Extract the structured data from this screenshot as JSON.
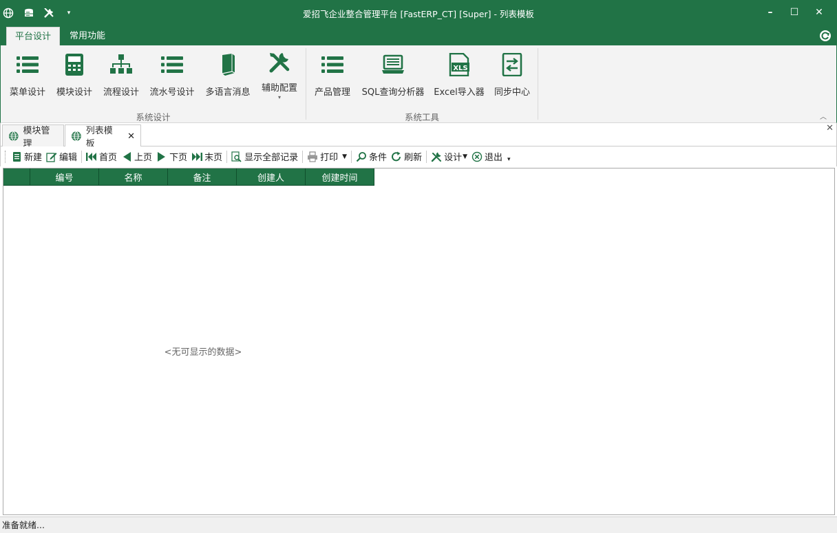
{
  "window": {
    "title": "爱招飞企业整合管理平台 [FastERP_CT] [Super] - 列表模板",
    "minimize_glyph": "–",
    "maximize_glyph": "☐",
    "close_glyph": "✕"
  },
  "quick_access": [
    "globe-icon",
    "database-icon",
    "tools-icon",
    "dropdown-arrow-icon"
  ],
  "ribbon_tabs": [
    {
      "label": "平台设计",
      "active": true
    },
    {
      "label": "常用功能",
      "active": false
    }
  ],
  "ribbon": {
    "groups": [
      {
        "label": "系统设计",
        "buttons": [
          {
            "label": "菜单设计",
            "icon": "list-icon"
          },
          {
            "label": "模块设计",
            "icon": "calculator-icon"
          },
          {
            "label": "流程设计",
            "icon": "org-chart-icon"
          },
          {
            "label": "流水号设计",
            "icon": "list-icon"
          },
          {
            "label": "多语言消息",
            "icon": "book-icon"
          },
          {
            "label": "辅助配置",
            "icon": "tools-icon",
            "dropdown": true
          }
        ]
      },
      {
        "label": "系统工具",
        "buttons": [
          {
            "label": "产品管理",
            "icon": "list-icon"
          },
          {
            "label": "SQL查询分析器",
            "icon": "laptop-icon"
          },
          {
            "label": "Excel导入器",
            "icon": "xls-icon",
            "icon_text": "XLS"
          },
          {
            "label": "同步中心",
            "icon": "sync-icon"
          }
        ]
      }
    ],
    "collapse_glyph": "︿"
  },
  "doc_tabs": [
    {
      "label": "模块管理",
      "active": false
    },
    {
      "label": "列表模板",
      "active": true,
      "close": "✕"
    }
  ],
  "doc_tabs_close_all": "✕",
  "toolbar": {
    "new": "新建",
    "edit": "编辑",
    "first": "首页",
    "prev": "上页",
    "next": "下页",
    "last": "末页",
    "show_all": "显示全部记录",
    "print": "打印",
    "filter": "条件",
    "refresh": "刷新",
    "design": "设计",
    "exit": "退出"
  },
  "grid": {
    "columns": [
      "",
      "编号",
      "名称",
      "备注",
      "创建人",
      "创建时间"
    ],
    "empty_text": "<无可显示的数据>"
  },
  "status": "准备就绪...",
  "colors": {
    "accent": "#217346",
    "header_border": "#0f4f2c"
  }
}
